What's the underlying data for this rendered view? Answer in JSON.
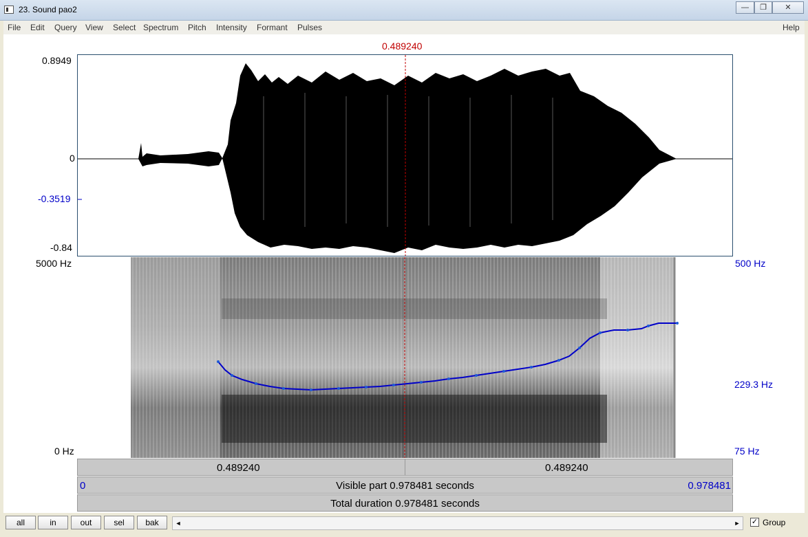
{
  "window": {
    "title": "23. Sound pao2",
    "minimize_glyph": "—",
    "restore_glyph": "❐",
    "close_glyph": "✕"
  },
  "menu": {
    "items": [
      "File",
      "Edit",
      "Query",
      "View",
      "Select",
      "Spectrum",
      "Pitch",
      "Intensity",
      "Formant",
      "Pulses"
    ],
    "help": "Help"
  },
  "cursor": {
    "time_label": "0.489240"
  },
  "waveform": {
    "y_max": "0.8949",
    "y_zero": "0",
    "y_marker": "-0.3519",
    "y_min": "-0.84"
  },
  "spectrogram": {
    "freq_max": "5000 Hz",
    "freq_min": "0 Hz",
    "pitch_max": "500 Hz",
    "pitch_marker": "229.3 Hz",
    "pitch_min": "75 Hz"
  },
  "timebar": {
    "left_label": "0.489240",
    "right_label": "0.489240",
    "visible_start": "0",
    "visible_text": "Visible part 0.978481 seconds",
    "visible_end": "0.978481",
    "total_text": "Total duration 0.978481 seconds"
  },
  "buttons": {
    "all": "all",
    "in": "in",
    "out": "out",
    "sel": "sel",
    "bak": "bak",
    "scroll_left": "◄",
    "scroll_right": "►",
    "group_label": "Group",
    "group_check": "✓"
  },
  "colors": {
    "cursor": "#c00000",
    "pitch": "#0000c8",
    "pitch_fill": "#1f5bd6"
  }
}
